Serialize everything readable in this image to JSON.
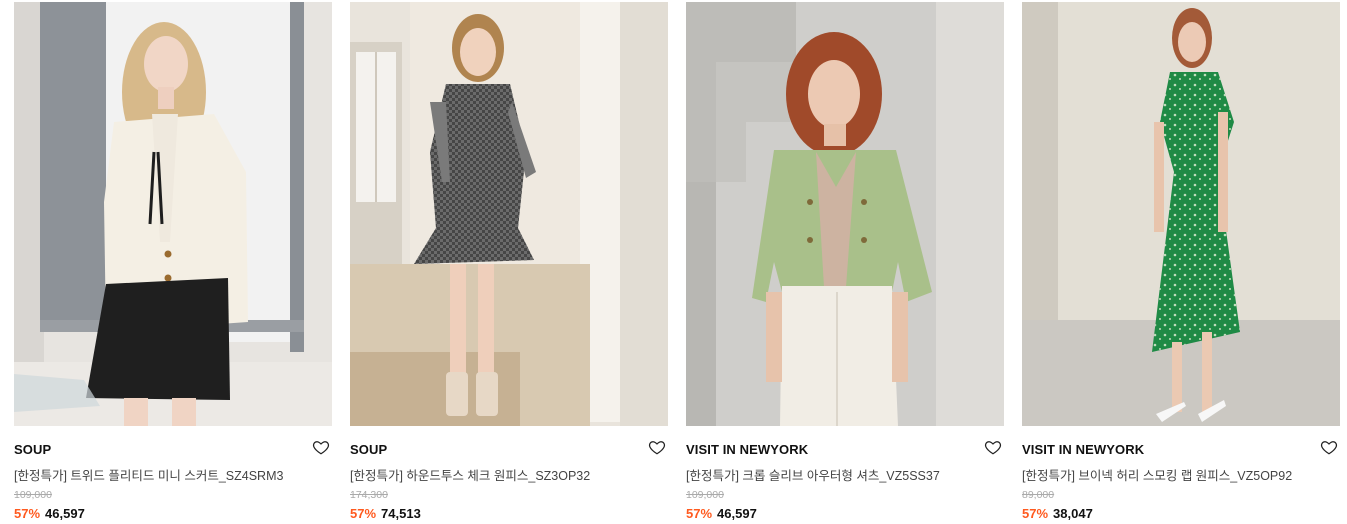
{
  "colors": {
    "discount": "#ff5a1f",
    "text": "#111111",
    "muted": "#444444",
    "strike": "#aaaaaa"
  },
  "products": [
    {
      "brand": "SOUP",
      "name": "[한정특가] 트위드 플리티드 미니 스커트_SZ4SRM3",
      "original_price": "109,000",
      "discount": "57%",
      "price": "46,597",
      "wishlist_icon": "heart-outline-icon"
    },
    {
      "brand": "SOUP",
      "name": "[한정특가] 하운드투스 체크 원피스_SZ3OP32",
      "original_price": "174,300",
      "discount": "57%",
      "price": "74,513",
      "wishlist_icon": "heart-outline-icon"
    },
    {
      "brand": "VISIT IN NEWYORK",
      "name": "[한정특가] 크롭 슬리브 아우터형 셔츠_VZ5SS37",
      "original_price": "109,000",
      "discount": "57%",
      "price": "46,597",
      "wishlist_icon": "heart-outline-icon"
    },
    {
      "brand": "VISIT IN NEWYORK",
      "name": "[한정특가] 브이넥 허리 스모킹 랩 원피스_VZ5OP92",
      "original_price": "89,000",
      "discount": "57%",
      "price": "38,047",
      "wishlist_icon": "heart-outline-icon"
    }
  ]
}
